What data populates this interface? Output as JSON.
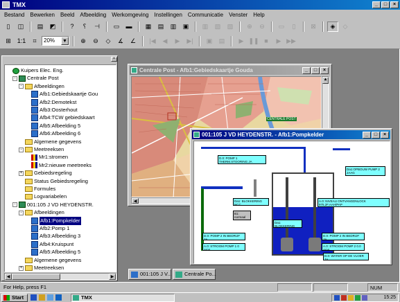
{
  "app": {
    "title": "TMX"
  },
  "menu": [
    "Bestand",
    "Bewerken",
    "Beeld",
    "Afbeelding",
    "Werkomgeving",
    "Instellingen",
    "Communicatie",
    "Venster",
    "Help"
  ],
  "toolbar2": {
    "scale_label": "1:1",
    "zoom_value": "20%"
  },
  "tree": {
    "items": [
      {
        "label": "Kuipers Elec. Eng.",
        "level": 0,
        "icon": "root-icon",
        "expander": ""
      },
      {
        "label": "Centrale Post",
        "level": 1,
        "icon": "station-icon",
        "expander": "-"
      },
      {
        "label": "Afbeeldingen",
        "level": 2,
        "icon": "folder-icon",
        "expander": "-"
      },
      {
        "label": "Afb1:Gebiedskaartje Gou",
        "level": 3,
        "icon": "doc-icon",
        "expander": ""
      },
      {
        "label": "Afb2:Demotekst",
        "level": 3,
        "icon": "doc-icon",
        "expander": ""
      },
      {
        "label": "Afb3:Oosterhout",
        "level": 3,
        "icon": "doc-icon",
        "expander": ""
      },
      {
        "label": "Afb4:TCW gebiedskaart",
        "level": 3,
        "icon": "doc-icon",
        "expander": ""
      },
      {
        "label": "Afb5:Afbeelding 5",
        "level": 3,
        "icon": "doc-icon",
        "expander": ""
      },
      {
        "label": "Afb6:Afbeelding 6",
        "level": 3,
        "icon": "doc-icon",
        "expander": ""
      },
      {
        "label": "Algemene gegevens",
        "level": 2,
        "icon": "folder-icon",
        "expander": ""
      },
      {
        "label": "Meetreeksen",
        "level": 2,
        "icon": "folder-icon",
        "expander": "-"
      },
      {
        "label": "Mr1:stromen",
        "level": 3,
        "icon": "chart-icon",
        "expander": ""
      },
      {
        "label": "Mr2:nieuwe meetreeks",
        "level": 3,
        "icon": "chart-icon",
        "expander": ""
      },
      {
        "label": "Gebiedsregeling",
        "level": 2,
        "icon": "folder-icon",
        "expander": "+"
      },
      {
        "label": "Status Gebiedsregeling",
        "level": 2,
        "icon": "folder-icon",
        "expander": ""
      },
      {
        "label": "Formules",
        "level": 2,
        "icon": "folder-icon",
        "expander": ""
      },
      {
        "label": "Logvariabelen",
        "level": 2,
        "icon": "folder-icon",
        "expander": ""
      },
      {
        "label": "001:105 J VD HEYDENSTR.",
        "level": 1,
        "icon": "station-icon",
        "expander": "-"
      },
      {
        "label": "Afbeeldingen",
        "level": 2,
        "icon": "folder-icon",
        "expander": "-"
      },
      {
        "label": "Afb1:Pompkelder",
        "level": 3,
        "icon": "doc-icon",
        "expander": "",
        "selected": true
      },
      {
        "label": "Afb2:Pomp 1",
        "level": 3,
        "icon": "doc-icon",
        "expander": ""
      },
      {
        "label": "Afb3:Afbeelding 3",
        "level": 3,
        "icon": "doc-icon",
        "expander": ""
      },
      {
        "label": "Afb4:Kruispunt",
        "level": 3,
        "icon": "doc-icon",
        "expander": ""
      },
      {
        "label": "Afb5:Afbeelding 5",
        "level": 3,
        "icon": "doc-icon",
        "expander": ""
      },
      {
        "label": "Algemene gegevens",
        "level": 2,
        "icon": "folder-icon",
        "expander": ""
      },
      {
        "label": "Meetreeksen",
        "level": 2,
        "icon": "folder-icon",
        "expander": "+"
      }
    ]
  },
  "window1": {
    "title": "Centrale Post - Afb1:Gebiedskaartje Gouda",
    "map_label": "CENTRALE POST"
  },
  "window2": {
    "title": "001:105 J VD HEYDENSTR. - Afb1:Pompkelder",
    "boxes": {
      "top_left": "D.0: POMP 1 THERM.STOORING JA",
      "top_right": "Da1:OPBOUW PUMP 2\nJAAG",
      "mid_left": "Da1: BLOKKERING\nNCC",
      "small_left": "B1:\nnormaal",
      "right_mid": "A.0: NIVEAU ONTVANGDNLOCK\n975,2F,AAH/PAP",
      "center": "Da1: BLOKKERING\nNCC",
      "bottom_left_1": "D.0: POMP 2 IN BEDRIJF\nJA",
      "bottom_left_2": "A.0: STROOM POMP 1\n0 Amp",
      "bottom_right_1": "D.0: POMP 2 IN BEDRIJF\nJA",
      "bottom_right_2": "A.0: STROOM POMP 2\n0.0 Amp",
      "bottom_right_3": "D.0: WATER OP DE VLOER\nJA"
    }
  },
  "minimized": [
    "001:105 J V...",
    "Centrale Po..."
  ],
  "status": {
    "help": "For Help, press F1",
    "num": "NUM"
  },
  "taskbar": {
    "start": "Start",
    "app": "TMX",
    "clock": "15:25"
  }
}
